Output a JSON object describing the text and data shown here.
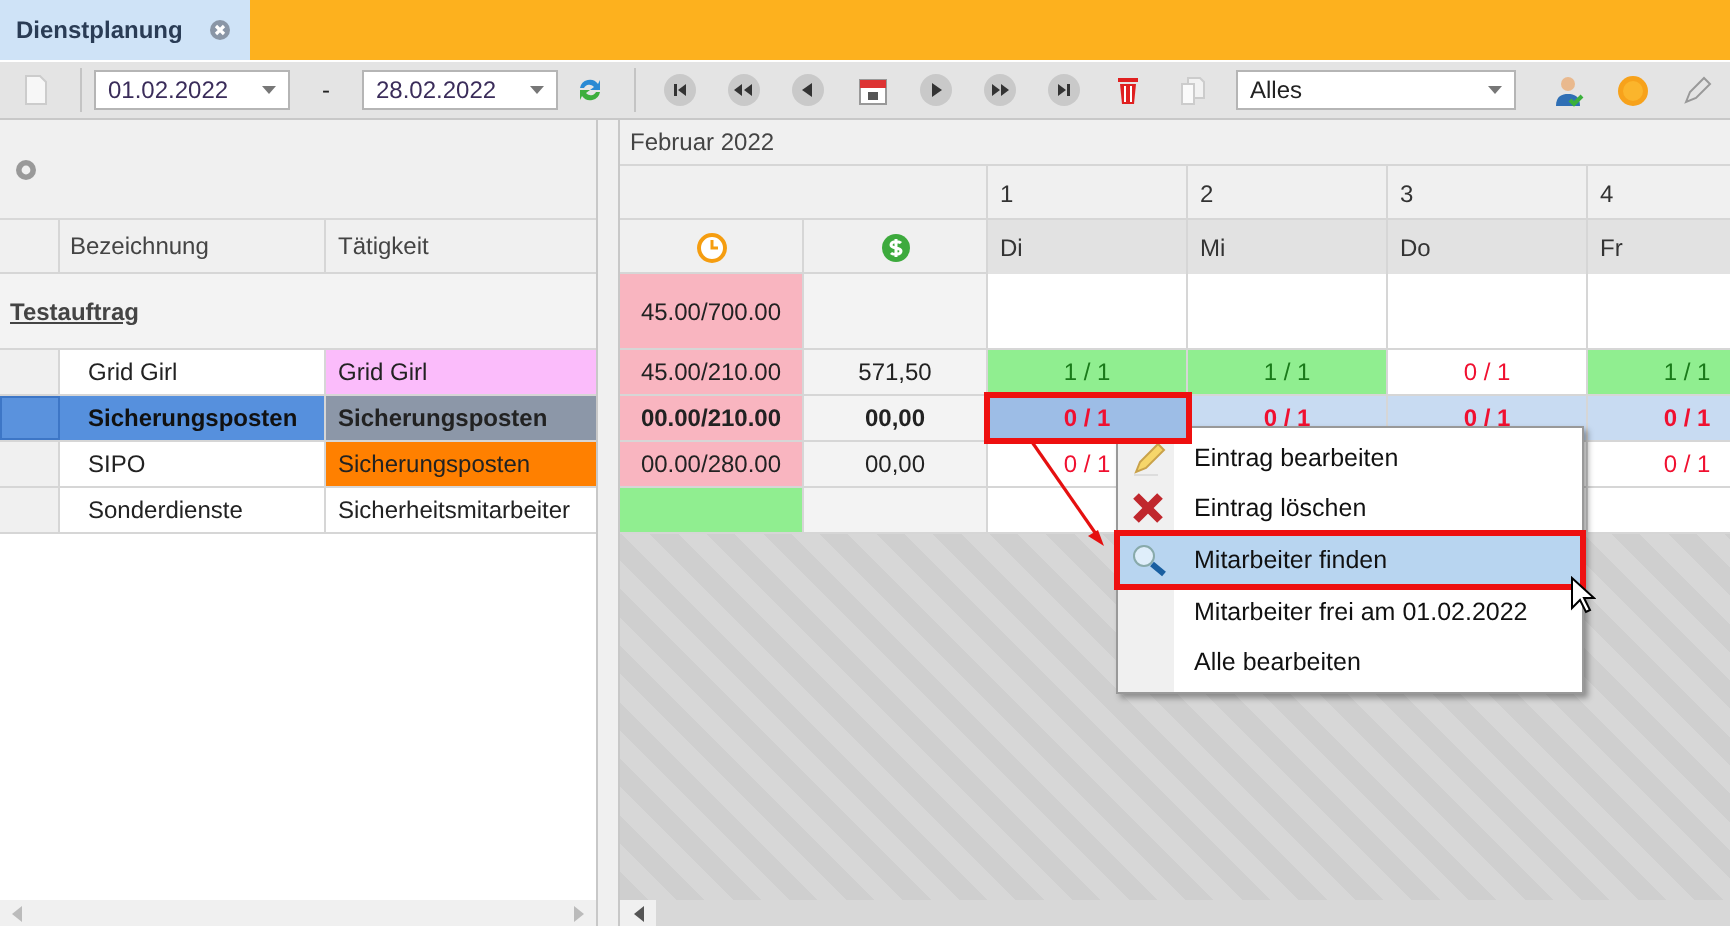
{
  "tab": {
    "title": "Dienstplanung",
    "selected": true
  },
  "toolbar": {
    "date_from": "01.02.2022",
    "range_separator": "-",
    "date_to": "28.02.2022",
    "filter": "Alles"
  },
  "left": {
    "columns": [
      "Bezeichnung",
      "Tätigkeit"
    ],
    "group": "Testauftrag",
    "rows": [
      {
        "name": "Grid Girl",
        "activity": "Grid Girl",
        "color": "#fbbcfb",
        "selected": false
      },
      {
        "name": "Sicherungsposten",
        "activity": "Sicherungsposten",
        "color": "#8c97a8",
        "selected": true
      },
      {
        "name": "SIPO",
        "activity": "Sicherungsposten",
        "color": "#ff8000",
        "selected": false
      },
      {
        "name": "Sonderdienste",
        "activity": "Sicherheitsmitarbeiter",
        "color": "#ffffff",
        "selected": false
      }
    ]
  },
  "plan": {
    "month": "Februar 2022",
    "days": [
      {
        "number": "1",
        "weekday": "Di"
      },
      {
        "number": "2",
        "weekday": "Mi"
      },
      {
        "number": "3",
        "weekday": "Do"
      },
      {
        "number": "4",
        "weekday": "Fr"
      }
    ],
    "group_hours": "45.00/700.00",
    "rows": [
      {
        "hours": {
          "text": "45.00/210.00",
          "kind": "short"
        },
        "money": "571,50",
        "selected": false,
        "cells": [
          {
            "text": "1 / 1",
            "kind": "filled",
            "focused": false
          },
          {
            "text": "1 / 1",
            "kind": "filled",
            "focused": false
          },
          {
            "text": "0 / 1",
            "kind": "open",
            "focused": false
          },
          {
            "text": "1 / 1",
            "kind": "filled",
            "focused": false
          }
        ]
      },
      {
        "hours": {
          "text": "00.00/210.00",
          "kind": "short"
        },
        "money": "00,00",
        "selected": true,
        "cells": [
          {
            "text": "0 / 1",
            "kind": "open",
            "focused": true
          },
          {
            "text": "0 / 1",
            "kind": "open",
            "focused": false
          },
          {
            "text": "0 / 1",
            "kind": "open",
            "focused": false
          },
          {
            "text": "0 / 1",
            "kind": "open",
            "focused": false
          }
        ]
      },
      {
        "hours": {
          "text": "00.00/280.00",
          "kind": "short"
        },
        "money": "00,00",
        "selected": false,
        "cells": [
          {
            "text": "0 / 1",
            "kind": "open",
            "focused": false
          },
          {
            "kind": "empty",
            "focused": false
          },
          {
            "kind": "empty",
            "focused": false
          },
          {
            "text": "0 / 1",
            "kind": "open",
            "focused": false
          }
        ]
      },
      {
        "hours": {
          "kind": "met"
        },
        "selected": false,
        "cells": [
          {
            "kind": "empty",
            "focused": false
          },
          {
            "kind": "empty",
            "focused": false
          },
          {
            "kind": "empty",
            "focused": false
          },
          {
            "kind": "empty",
            "focused": false
          }
        ]
      }
    ]
  },
  "context_menu": [
    {
      "label": "Eintrag bearbeiten",
      "kind": "edit",
      "selected": false
    },
    {
      "label": "Eintrag löschen",
      "kind": "delete",
      "selected": false
    },
    {
      "label": "Mitarbeiter finden",
      "kind": "search",
      "selected": true
    },
    {
      "label": "Mitarbeiter frei am 01.02.2022",
      "kind": "plain",
      "selected": false
    },
    {
      "label": "Alle bearbeiten",
      "kind": "plain",
      "selected": false
    }
  ]
}
